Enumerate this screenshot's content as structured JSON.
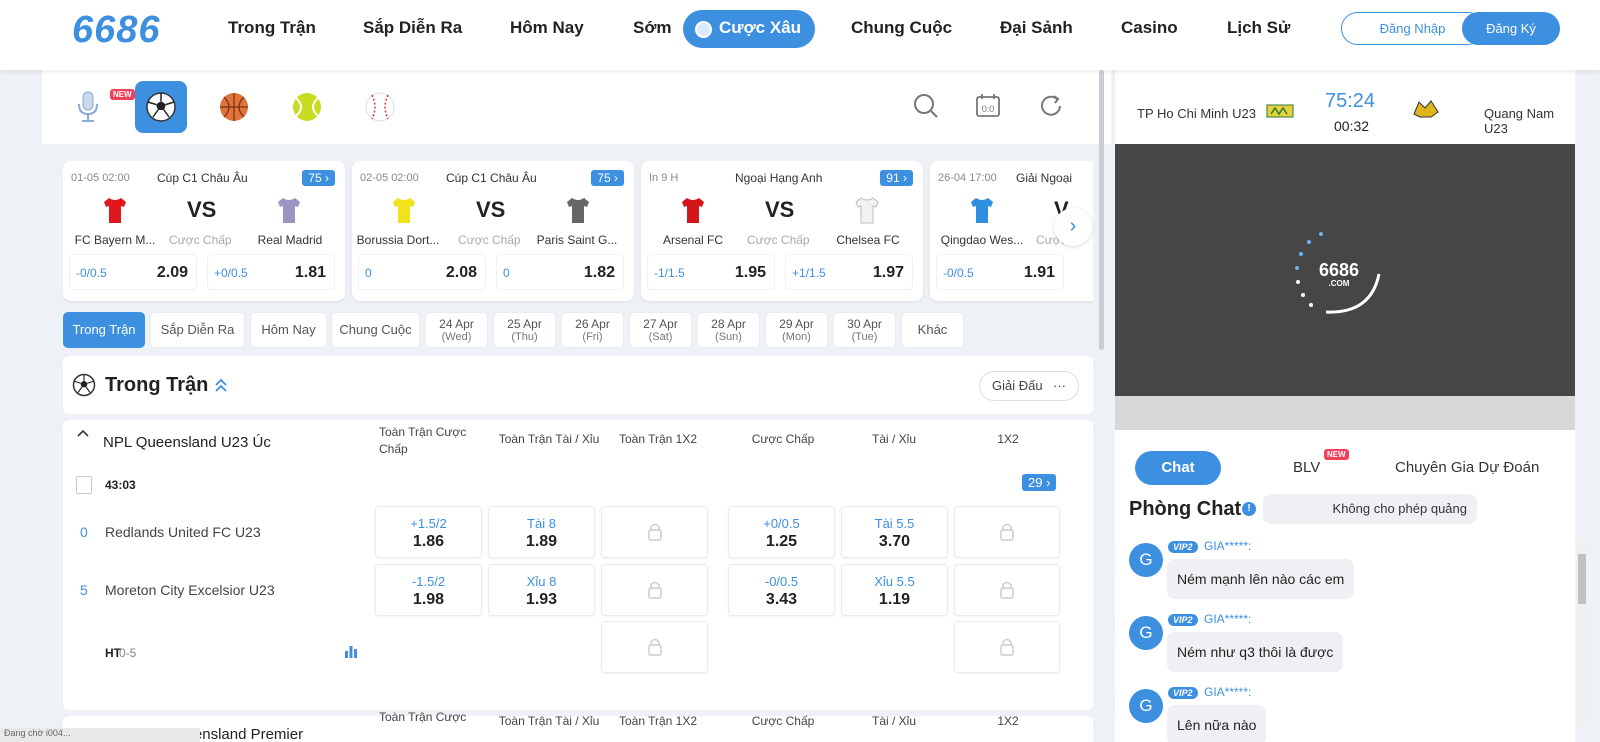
{
  "header": {
    "logo": "6686",
    "nav": [
      "Trong Trận",
      "Sắp Diễn Ra",
      "Hôm Nay",
      "Sớm",
      "Cược Xâu",
      "Chung Cuộc",
      "Đại Sảnh",
      "Casino",
      "Lịch Sử"
    ],
    "login": "Đăng Nhập",
    "register": "Đăng Ký"
  },
  "sports": {
    "new_badge": "NEW",
    "icons": [
      "microphone-icon",
      "soccer-icon",
      "basketball-icon",
      "tennis-icon",
      "baseball-icon"
    ]
  },
  "cards": [
    {
      "date": "01-05 02:00",
      "league": "Cúp C1 Châu Âu",
      "count": "75",
      "vs": "VS",
      "home": "FC Bayern M...",
      "away": "Real Madrid",
      "type": "Cược Chấp",
      "h1": "-0/0.5",
      "o1": "2.09",
      "h2": "+0/0.5",
      "o2": "1.81"
    },
    {
      "date": "02-05 02:00",
      "league": "Cúp C1 Châu Âu",
      "count": "75",
      "vs": "VS",
      "home": "Borussia Dort...",
      "away": "Paris Saint G...",
      "type": "Cược Chấp",
      "h1": "0",
      "o1": "2.08",
      "h2": "0",
      "o2": "1.82"
    },
    {
      "date": "In 9 H",
      "league": "Ngoại Hạng Anh",
      "count": "91",
      "vs": "VS",
      "home": "Arsenal FC",
      "away": "Chelsea FC",
      "type": "Cược Chấp",
      "h1": "-1/1.5",
      "o1": "1.95",
      "h2": "+1/1.5",
      "o2": "1.97"
    },
    {
      "date": "26-04 17:00",
      "league": "Giải Ngoại",
      "count": "",
      "vs": "V",
      "home": "Qingdao Wes...",
      "away": "",
      "type": "Cược",
      "h1": "-0/0.5",
      "o1": "1.91",
      "h2": "",
      "o2": ""
    }
  ],
  "tabs": [
    {
      "label": "Trong Trận"
    },
    {
      "label": "Sắp Diễn Ra"
    },
    {
      "label": "Hôm Nay"
    },
    {
      "label": "Chung Cuộc"
    },
    {
      "d1": "24 Apr",
      "d2": "(Wed)"
    },
    {
      "d1": "25 Apr",
      "d2": "(Thu)"
    },
    {
      "d1": "26 Apr",
      "d2": "(Fri)"
    },
    {
      "d1": "27 Apr",
      "d2": "(Sat)"
    },
    {
      "d1": "28 Apr",
      "d2": "(Sun)"
    },
    {
      "d1": "29 Apr",
      "d2": "(Mon)"
    },
    {
      "d1": "30 Apr",
      "d2": "(Tue)"
    },
    {
      "label": "Khác"
    }
  ],
  "section": {
    "title": "Trong Trận",
    "filter": "Giải Đấu",
    "more": "···"
  },
  "league": {
    "name": "NPL Queensland U23 Úc",
    "cols": [
      "Toàn Trận Cược Chấp",
      "Toàn Trận Tài / Xỉu",
      "Toàn Trận 1X2",
      "Cược Chấp",
      "Tài / Xỉu",
      "1X2"
    ],
    "time": "43:03",
    "count": "29",
    "home": {
      "score": "0",
      "name": "Redlands United FC U23",
      "ah_h": "+1.5/2",
      "ah_o": "1.86",
      "ou_h": "Tài 8",
      "ou_o": "1.89",
      "hah_h": "+0/0.5",
      "hah_o": "1.25",
      "hou_h": "Tài 5.5",
      "hou_o": "3.70"
    },
    "away": {
      "score": "5",
      "name": "Moreton City Excelsior U23",
      "ah_h": "-1.5/2",
      "ah_o": "1.98",
      "ou_h": "Xỉu 8",
      "ou_o": "1.93",
      "hah_h": "-0/0.5",
      "hah_o": "3.43",
      "hou_h": "Xỉu 5.5",
      "hou_o": "1.19"
    },
    "ht_label": "HT",
    "ht": "0-5"
  },
  "league2": {
    "name": "Australia Queensland Premier",
    "cols": [
      "Toàn Trận Cược",
      "Toàn Trận Tài / Xỉu",
      "Toàn Trận 1X2",
      "Cược Chấp",
      "Tài / Xỉu",
      "1X2"
    ]
  },
  "live": {
    "home": "TP Ho Chi Minh U23",
    "away": "Quang Nam U23",
    "clock": "75:24",
    "sub": "00:32",
    "video_logo": "6686",
    ".com": ".COM"
  },
  "chat": {
    "tabs": [
      "Chat",
      "BLV",
      "Chuyên Gia Dự Đoán"
    ],
    "blv_badge": "NEW",
    "title": "Phòng Chat",
    "notice": "Không cho phép quảng",
    "messages": [
      {
        "avatar": "G",
        "vip": "VIP2",
        "user": "GIA*****:",
        "text": "Ném mạnh lên nào các em"
      },
      {
        "avatar": "G",
        "vip": "VIP2",
        "user": "GIA*****:",
        "text": "Ném như q3 thôi là được"
      },
      {
        "avatar": "G",
        "vip": "VIP2",
        "user": "GIA*****:",
        "text": "Lên nữa nào"
      }
    ]
  },
  "status_text": "Đang chờ i004..."
}
